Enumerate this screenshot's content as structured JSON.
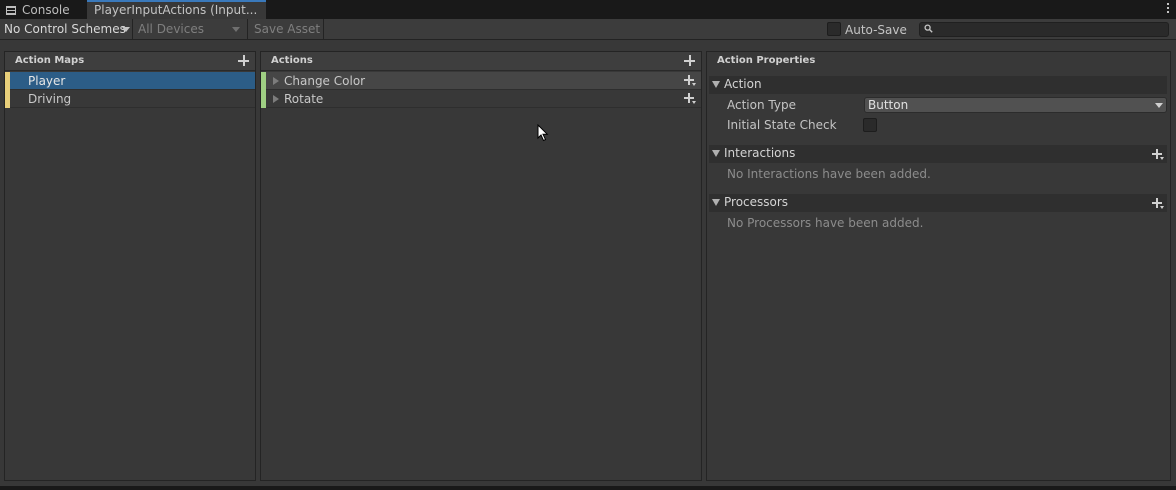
{
  "tabs": {
    "console": "Console",
    "input_actions": "PlayerInputActions (Input..."
  },
  "toolbar": {
    "control_schemes": "No Control Schemes",
    "devices": "All Devices",
    "save_asset": "Save Asset",
    "auto_save": "Auto-Save",
    "auto_save_checked": false,
    "search_value": ""
  },
  "action_maps": {
    "title": "Action Maps",
    "items": [
      {
        "label": "Player",
        "selected": true
      },
      {
        "label": "Driving",
        "selected": false
      }
    ]
  },
  "actions": {
    "title": "Actions",
    "items": [
      {
        "label": "Change Color"
      },
      {
        "label": "Rotate"
      }
    ]
  },
  "properties": {
    "title": "Action Properties",
    "action_section": "Action",
    "action_type_label": "Action Type",
    "action_type_value": "Button",
    "initial_state_label": "Initial State Check",
    "initial_state_checked": false,
    "interactions_section": "Interactions",
    "interactions_empty": "No Interactions have been added.",
    "processors_section": "Processors",
    "processors_empty": "No Processors have been added."
  },
  "colors": {
    "accent": "#3a79bb",
    "selection": "#2c5d87",
    "action_map_bar": "#e8cf7a",
    "action_bar": "#9fcf83"
  }
}
